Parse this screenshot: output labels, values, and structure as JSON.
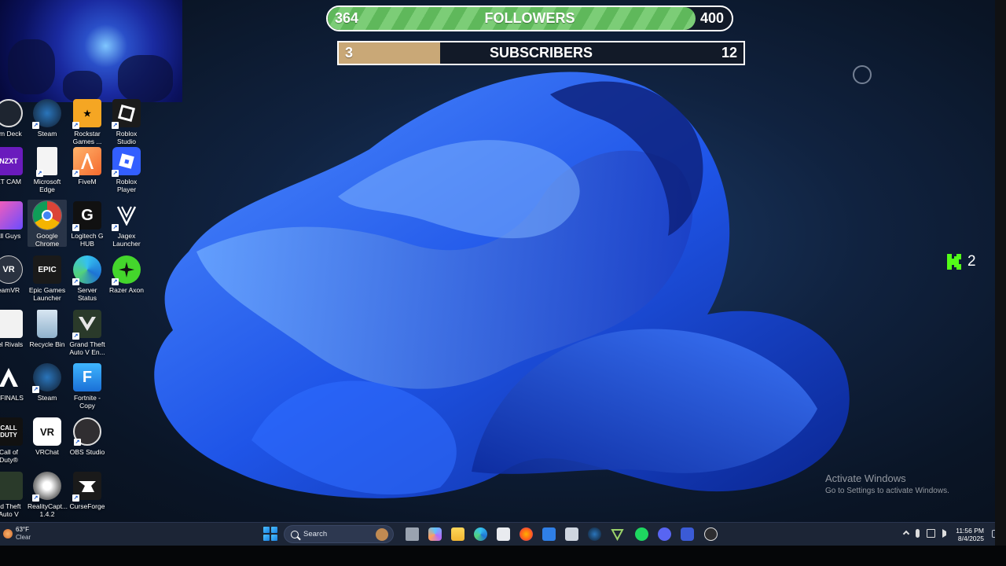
{
  "followers": {
    "current": "364",
    "label": "FOLLOWERS",
    "goal": "400",
    "progress": 0.91
  },
  "subscribers": {
    "current": "3",
    "label": "SUBSCRIBERS",
    "goal": "12",
    "progress": 0.25
  },
  "kick": {
    "count": "2"
  },
  "activate": {
    "title": "Activate Windows",
    "subtitle": "Go to Settings to activate Windows."
  },
  "icons": {
    "c0r0": "am Deck",
    "c1r0": "Steam",
    "c2r0": "Rockstar Games ...",
    "c3r0": "Roblox Studio",
    "c0r1": "XT CAM",
    "c1r1": "Microsoft Edge",
    "c2r1": "FiveM",
    "c3r1": "Roblox Player",
    "c0r2": "all Guys",
    "c1r2": "Google Chrome",
    "c2r2": "Logitech G HUB",
    "c3r2": "Jagex Launcher",
    "c0r3": "eamVR",
    "c1r3": "Epic Games Launcher",
    "c2r3": "Server Status",
    "c3r3": "Razer Axon",
    "c0r4": "vel Rivals",
    "c1r4": "Recycle Bin",
    "c2r4": "Grand Theft Auto V En...",
    "c0r5": "E FINALS",
    "c1r5": "Steam",
    "c2r5": "Fortnite - Copy",
    "c0r6": "Call of Duty®",
    "c1r6": "VRChat",
    "c2r6": "OBS Studio",
    "c0r7": "nd Theft Auto V",
    "c1r7": "RealityCapt... 1.4.2",
    "c2r7": "CurseForge"
  },
  "icon_glyphs": {
    "nzxt": "NZXT",
    "epic": "EPIC",
    "vr": "VR",
    "fortnite": "F",
    "vrchat": "VR",
    "cod": "CALL DUTY"
  },
  "taskbar": {
    "weather_temp": "63°F",
    "weather_cond": "Clear",
    "search_placeholder": "Search",
    "time": "11:56 PM",
    "date": "8/4/2025"
  },
  "colors": {
    "followers_fill": "#5fb85b",
    "subs_fill": "#c9a877",
    "kick_green": "#53fc18",
    "taskbar": "#1c2536"
  }
}
